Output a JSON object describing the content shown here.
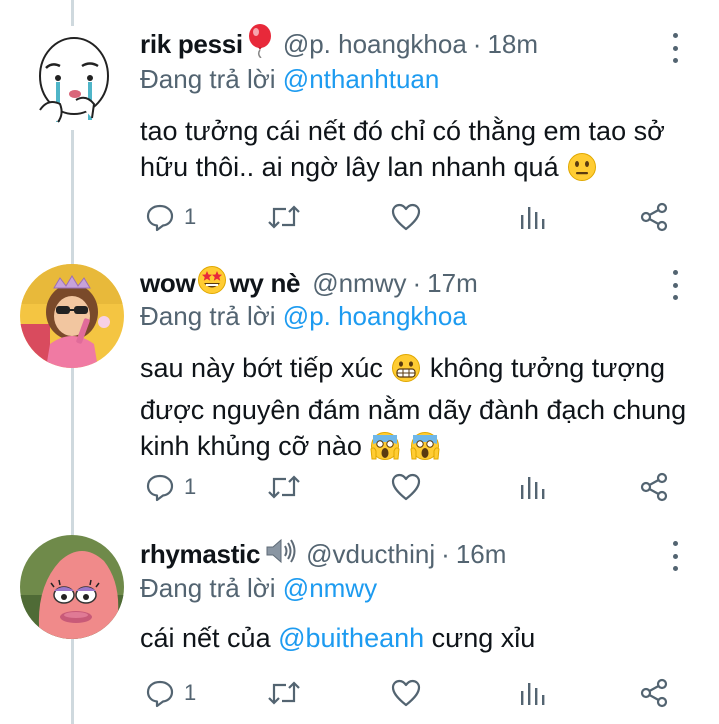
{
  "tweets": [
    {
      "name": "rik pessi",
      "name_emoji": "balloon",
      "handle": "@p. hoangkhoa",
      "time": "18m",
      "reply_label": "Đang trả lời",
      "reply_to": "@nthanhtuan",
      "text": "tao tưởng cái nết đó chỉ có thằng em tao sở hữu thôi.. ai ngờ lây lan nhanh quá",
      "text_emoji": "neutral-face-emoji",
      "reply_count": "1"
    },
    {
      "name_part1": "wow",
      "name_emoji": "star-struck-emoji",
      "name_part2": "wy nè",
      "handle": "@nmwy",
      "time": "17m",
      "reply_label": "Đang trả lời",
      "reply_to": "@p. hoangkhoa",
      "text_part1": "sau này bớt tiếp xúc",
      "text_part2": "không tưởng tượng được nguyên đám nằm dãy đành đạch chung kinh khủng cỡ nào",
      "text_emoji": "grimacing-face-emoji, screaming-face-emoji x2",
      "reply_count": "1"
    },
    {
      "name": "rhymastic",
      "name_emoji": "speaker-emoji",
      "handle": "@vducthinj",
      "time": "16m",
      "reply_label": "Đang trả lời",
      "reply_to": "@nmwy",
      "text_part1": "cái nết của",
      "text_mention": "@buitheanh",
      "text_part2": "cưng xỉu",
      "reply_count": "1"
    }
  ],
  "colors": {
    "accent": "#1d9bf0",
    "secondary_text": "#536471",
    "thread_line": "#cfd9de"
  }
}
